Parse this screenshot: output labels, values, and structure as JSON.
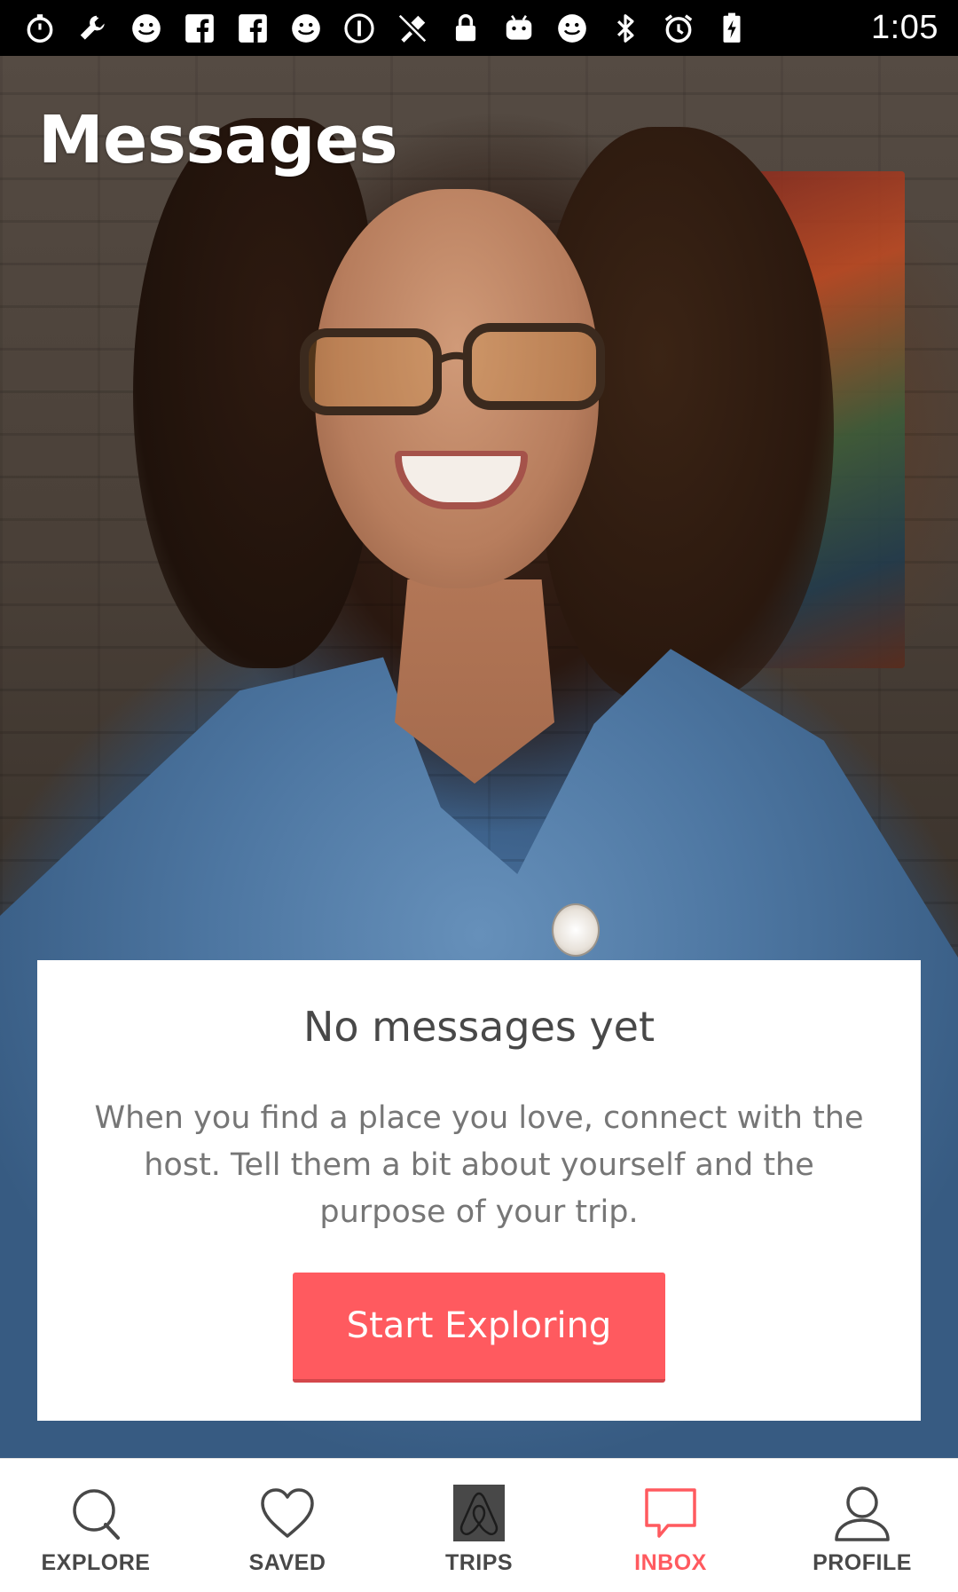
{
  "status_bar": {
    "time": "1:05",
    "icons": [
      "stopwatch-icon",
      "wrench-icon",
      "smiley-icon",
      "facebook-icon",
      "facebook-icon",
      "smiley-icon",
      "info-circle-icon",
      "fake-gps-icon",
      "lock-icon",
      "android-icon",
      "smiley-icon",
      "bluetooth-icon",
      "alarm-icon",
      "battery-charging-icon"
    ]
  },
  "header": {
    "title": "Messages"
  },
  "empty_state": {
    "title": "No messages yet",
    "body": "When you find a place you love, connect with the host. Tell them a bit about yourself and the purpose of your trip.",
    "button_label": "Start Exploring",
    "button_color": "#ff5a5f"
  },
  "bottom_nav": {
    "active_color": "#ff5a5f",
    "inactive_color": "#484848",
    "items": [
      {
        "label": "EXPLORE",
        "icon": "search-icon",
        "active": false
      },
      {
        "label": "SAVED",
        "icon": "heart-icon",
        "active": false
      },
      {
        "label": "TRIPS",
        "icon": "airbnb-logo-icon",
        "active": false
      },
      {
        "label": "INBOX",
        "icon": "chat-bubble-icon",
        "active": true
      },
      {
        "label": "PROFILE",
        "icon": "person-icon",
        "active": false
      }
    ]
  }
}
